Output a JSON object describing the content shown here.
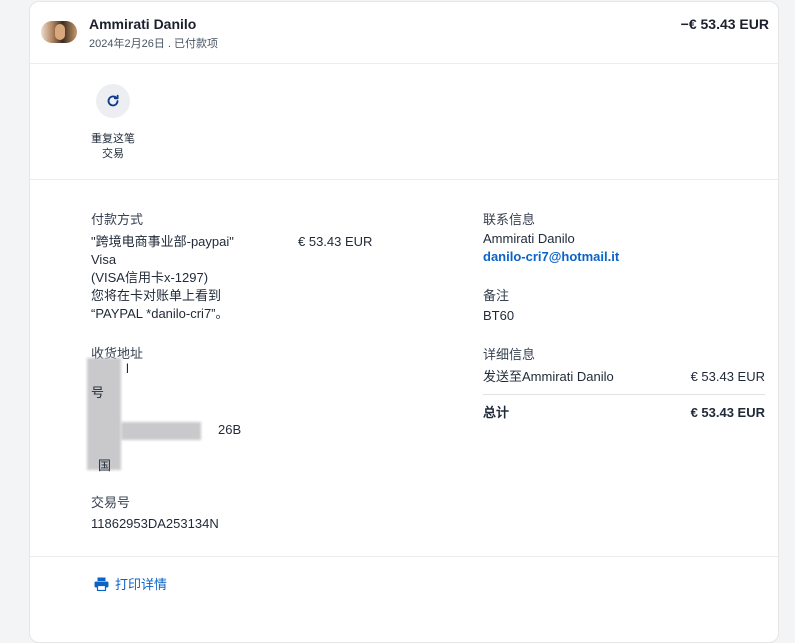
{
  "header": {
    "name": "Ammirati Danilo",
    "subtitle": "2024年2月26日 . 已付款项",
    "amount": "−€ 53.43 EUR"
  },
  "actions": {
    "repeat_label": "重复这笔交易"
  },
  "payment": {
    "title": "付款方式",
    "line1": "\"跨境电商事业部-paypai\"",
    "line1_amount": "€ 53.43 EUR",
    "line2": "Visa",
    "line3": "(VISA信用卡x-1297)",
    "line4": "您将在卡对账单上看到",
    "line5": "“PAYPAL *danilo-cri7”。"
  },
  "shipping": {
    "title": "收货地址",
    "line_partial1": "l",
    "line_partial2": "号",
    "line_partial3": "26B",
    "line_partial4": "国"
  },
  "transaction": {
    "title": "交易号",
    "id": "11862953DA253134N"
  },
  "contact": {
    "title": "联系信息",
    "name": "Ammirati Danilo",
    "email": "danilo-cri7@hotmail.it"
  },
  "note": {
    "title": "备注",
    "value": "BT60"
  },
  "details": {
    "title": "详细信息",
    "ship_label": "发送至Ammirati Danilo",
    "ship_amount": "€ 53.43 EUR",
    "total_label": "总计",
    "total_amount": "€ 53.43 EUR"
  },
  "footer": {
    "print_label": "打印详情"
  },
  "colors": {
    "link": "#0b63c9",
    "text": "#1f2937"
  },
  "icons": {
    "repeat": "refresh-icon",
    "print": "printer-icon"
  }
}
